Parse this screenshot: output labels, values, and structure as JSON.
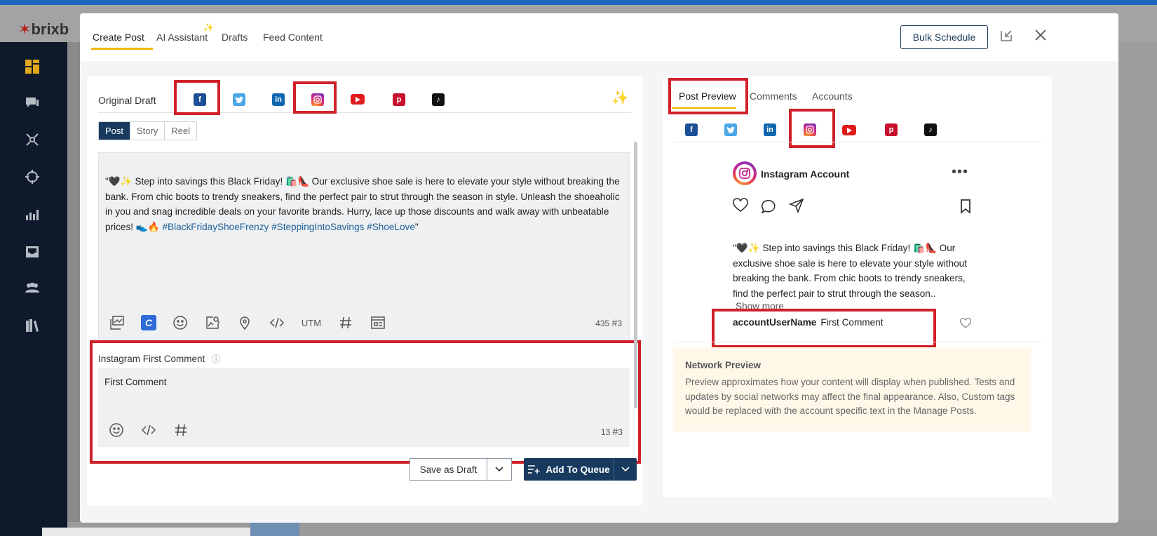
{
  "app": {
    "logo_text": "brixb",
    "header_right_icons": [
      "leaf-icon",
      "user-icon"
    ]
  },
  "sidebar": {
    "icons": [
      "dashboard-icon",
      "messages-icon",
      "network-icon",
      "target-icon",
      "analytics-icon",
      "inbox-icon",
      "team-icon",
      "library-icon"
    ]
  },
  "modal": {
    "tabs": [
      {
        "label": "Create Post",
        "active": true
      },
      {
        "label": "AI Assistant",
        "active": false
      },
      {
        "label": "Drafts",
        "active": false
      },
      {
        "label": "Feed Content",
        "active": false
      }
    ],
    "bulk_schedule_label": "Bulk Schedule"
  },
  "editor": {
    "original_draft_label": "Original Draft",
    "networks": [
      "facebook",
      "twitter",
      "linkedin",
      "instagram",
      "youtube",
      "pinterest",
      "tiktok"
    ],
    "post_types": [
      {
        "label": "Post",
        "active": true
      },
      {
        "label": "Story",
        "active": false
      },
      {
        "label": "Reel",
        "active": false
      }
    ],
    "body_text": "\"🖤✨ Step into savings this Black Friday! 🛍️👠 Our exclusive shoe sale is here to elevate your style without breaking the bank. From chic boots to trendy sneakers, find the perfect pair to strut through the season in style. Unleash the shoeaholic in you and snag incredible deals on your favorite brands. Hurry, lace up those discounts and walk away with unbeatable prices! 👟🔥 ",
    "hashtags_text": "#BlackFridayShoeFrenzy #SteppingIntoSavings #ShoeLove",
    "body_end": "\"",
    "utm_label": "UTM",
    "char_count": "435",
    "hashtag_count": "3"
  },
  "first_comment": {
    "label": "Instagram First Comment",
    "value": "First Comment",
    "char_count": "13",
    "hashtag_count": "3"
  },
  "actions": {
    "save_draft_label": "Save as Draft",
    "add_queue_label": "Add To Queue"
  },
  "preview": {
    "tabs": [
      {
        "label": "Post Preview",
        "active": true
      },
      {
        "label": "Comments",
        "active": false
      },
      {
        "label": "Accounts",
        "active": false
      }
    ],
    "account_name": "Instagram Account",
    "more_label": "•••",
    "caption": "\"🖤✨ Step into savings this Black Friday! 🛍️👠 Our exclusive shoe sale is here to elevate your style without breaking the bank. From chic boots to trendy sneakers, find the perfect pair to strut through the season..",
    "show_more_label": "Show more",
    "comment_user": "accountUserName",
    "comment_text": "First Comment",
    "network_preview_title": "Network Preview",
    "network_preview_text": "Preview approximates how your content will display when published. Tests and updates by social networks may affect the final appearance. Also, Custom tags would be replaced with the account specific text in the Manage Posts."
  },
  "colors": {
    "accent": "#f2b705",
    "primary": "#173a5e",
    "highlight": "#d0212a",
    "facebook": "#1c4f96",
    "twitter": "#4aa6e8",
    "linkedin": "#0e67b0",
    "youtube": "#e01b1b",
    "pinterest": "#c8102e",
    "tiktok": "#111111"
  }
}
